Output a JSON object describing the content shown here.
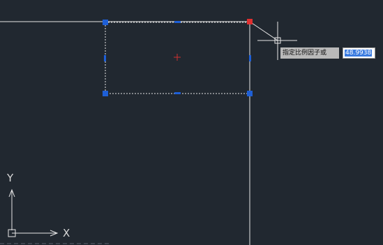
{
  "dynamic_input": {
    "prompt": "指定比例因子或",
    "value": "48.9938"
  },
  "ucs": {
    "x_label": "X",
    "y_label": "Y"
  },
  "colors": {
    "background": "#212830",
    "geometry": "#e6e6e6",
    "grip_unselected": "#1e5fd6",
    "grip_hot": "#e03030",
    "center_mark": "#d03030",
    "cursor": "#e6e6e6"
  },
  "icons": {
    "cursor": "crosshair-cursor-icon",
    "center": "center-cross-icon",
    "ucs": "ucs-axis-icon"
  }
}
